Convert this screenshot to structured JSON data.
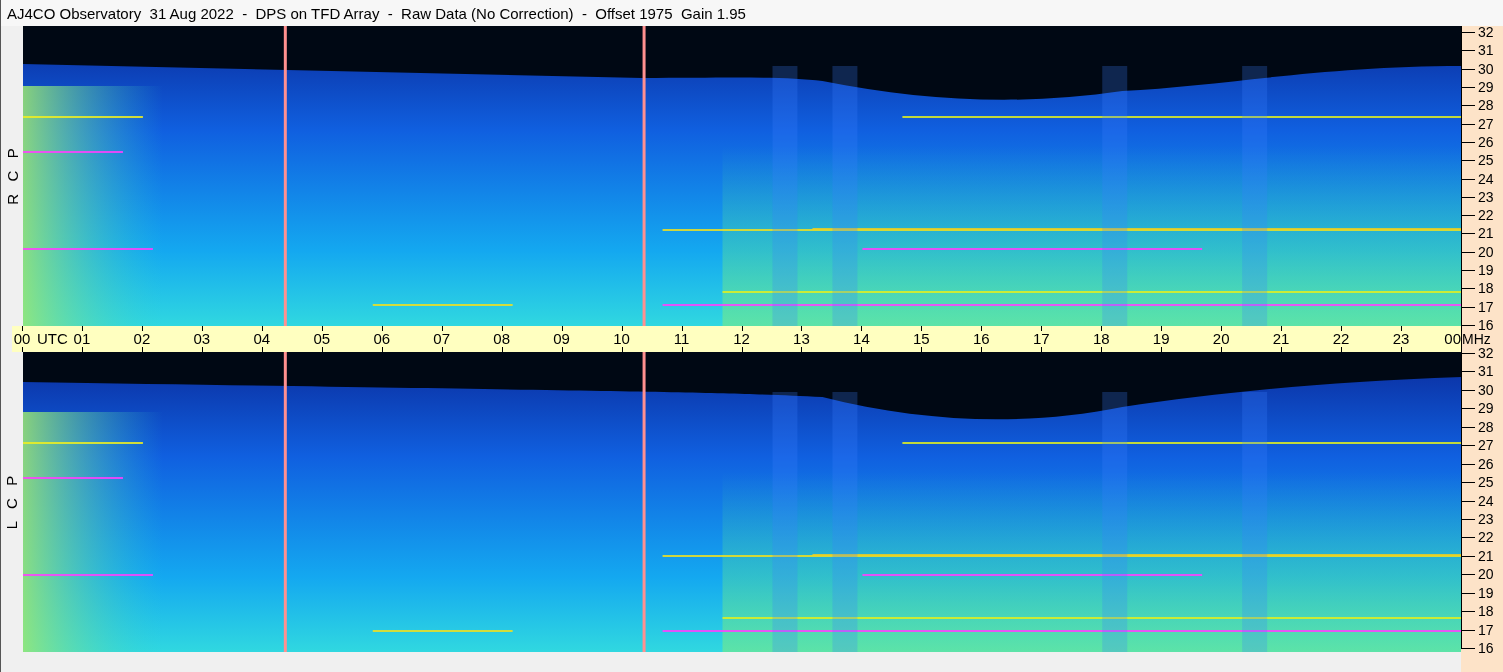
{
  "title": "AJ4CO Observatory  31 Aug 2022  -  DPS on TFD Array  -  Raw Data (No Correction)  -  Offset 1975  Gain 1.95",
  "panels": [
    {
      "label": "R C P",
      "kind": "picture",
      "frequency_ticks": [
        "32",
        "31",
        "30",
        "29",
        "28",
        "27",
        "26",
        "25",
        "24",
        "23",
        "22",
        "21",
        "20",
        "19",
        "18",
        "17",
        "16"
      ]
    },
    {
      "label": "L C P",
      "kind": "picture",
      "frequency_ticks": [
        "32",
        "31",
        "30",
        "29",
        "28",
        "27",
        "26",
        "25",
        "24",
        "23",
        "22",
        "21",
        "20",
        "19",
        "18",
        "17",
        "16"
      ]
    }
  ],
  "time_axis": {
    "ticks": [
      "00",
      "01",
      "02",
      "03",
      "04",
      "05",
      "06",
      "07",
      "08",
      "09",
      "10",
      "11",
      "12",
      "13",
      "14",
      "15",
      "16",
      "17",
      "18",
      "19",
      "20",
      "21",
      "22",
      "23",
      "00"
    ],
    "unit": "UTC"
  },
  "frequency_axis": {
    "unit": "MHz"
  }
}
